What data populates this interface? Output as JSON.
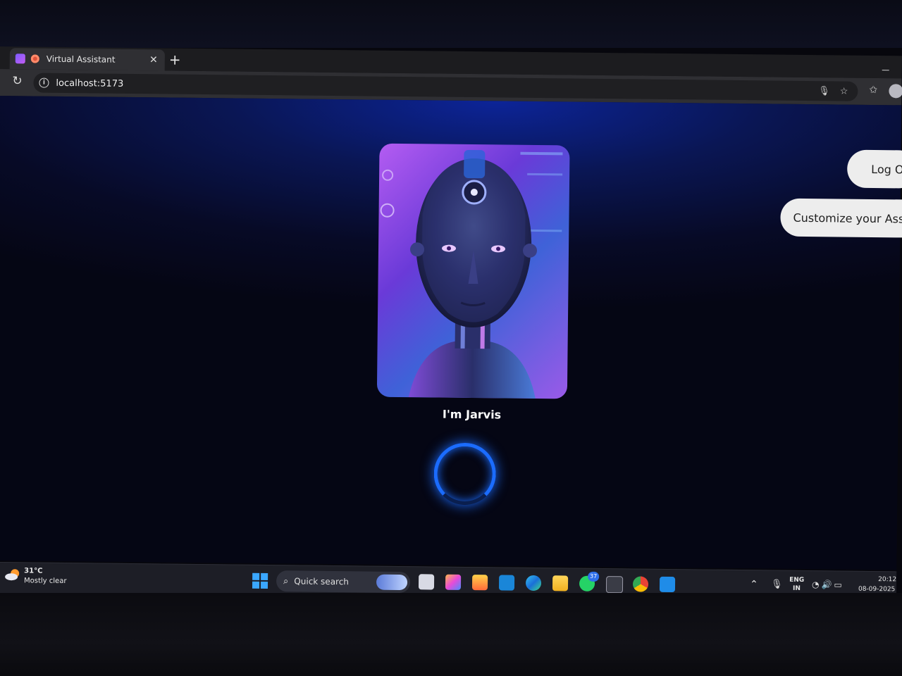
{
  "browser": {
    "tab_title": "Virtual Assistant",
    "url": "localhost:5173"
  },
  "assistant": {
    "name_label": "I'm Jarvis",
    "logout_label": "Log O",
    "customize_label": "Customize your Assis"
  },
  "taskbar": {
    "weather_temp": "31°C",
    "weather_condition": "Mostly clear",
    "search_label": "Quick search",
    "whatsapp_badge": "37",
    "language_top": "ENG",
    "language_bottom": "IN",
    "time": "20:12",
    "date": "08-09-2025"
  },
  "icons": {
    "apps": [
      "windows-start-icon",
      "search-icon",
      "task-view-icon",
      "copilot-icon",
      "store-icon",
      "dell-icon",
      "edge-icon",
      "file-explorer-icon",
      "whatsapp-icon",
      "terminal-icon",
      "chrome-icon",
      "vscode-icon"
    ]
  },
  "colors": {
    "page_glow": "#0c2498",
    "spinner": "#1b6cff",
    "pill_bg": "#ededed"
  }
}
